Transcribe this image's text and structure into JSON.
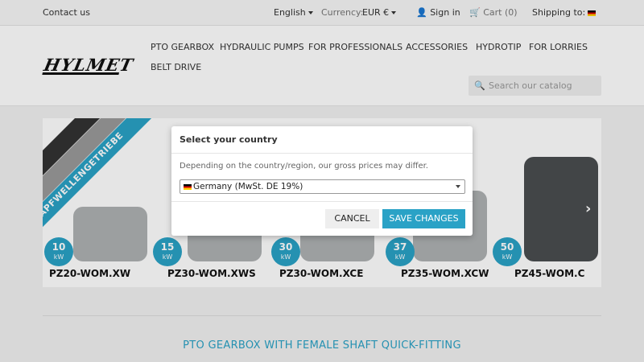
{
  "topbar": {
    "contact": "Contact us",
    "language": "English",
    "currency_label": "Currency:",
    "currency_value": "EUR €",
    "signin": "Sign in",
    "cart": "Cart (0)",
    "shipping": "Shipping to:"
  },
  "header": {
    "logo": "HYLMET",
    "nav": [
      "PTO GEARBOX",
      "HYDRAULIC PUMPS",
      "FOR PROFESSIONALS",
      "ACCESSORIES",
      "HYDROTIP",
      "FOR LORRIES",
      "BELT DRIVE"
    ],
    "search_placeholder": "Search our catalog"
  },
  "banner": {
    "ribbon": "ZAPFWELLENGETRIEBE",
    "products": [
      {
        "power": "10",
        "unit": "kW",
        "name": "PZ20-WOM.XW"
      },
      {
        "power": "15",
        "unit": "kW",
        "name": "PZ30-WOM.XWS"
      },
      {
        "power": "30",
        "unit": "kW",
        "name": "PZ30-WOM.XCE"
      },
      {
        "power": "37",
        "unit": "kW",
        "name": "PZ35-WOM.XCW"
      },
      {
        "power": "50",
        "unit": "kW",
        "name": "PZ45-WOM.C"
      }
    ],
    "accent_color": "#2aa2c6"
  },
  "section": {
    "title": "PTO GEARBOX WITH FEMALE SHAFT QUICK-FITTING"
  },
  "modal": {
    "title": "Select your country",
    "description": "Depending on the country/region, our gross prices may differ.",
    "selected_country": "Germany (MwSt. DE 19%)",
    "cancel_label": "CANCEL",
    "save_label": "SAVE CHANGES"
  }
}
